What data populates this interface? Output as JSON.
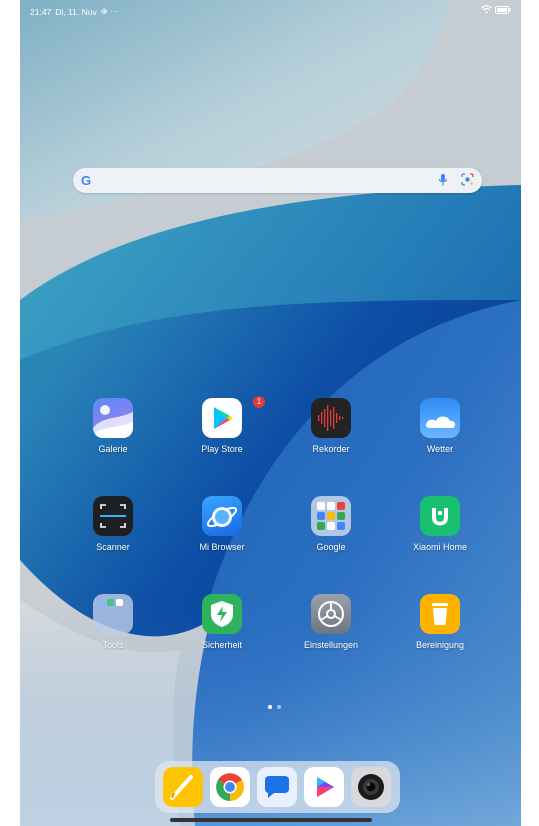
{
  "status_bar": {
    "time": "21:47",
    "date": "Di, 11. Nov",
    "extra": "⊕ ···",
    "right_icons": [
      "wifi-icon",
      "battery-icon"
    ]
  },
  "search_bar": {
    "logo": "G",
    "icons": [
      "mic-icon",
      "lens-icon"
    ]
  },
  "apps": [
    {
      "label": "Galerie",
      "icon": "gallery-icon"
    },
    {
      "label": "Play Store",
      "icon": "play-store-icon",
      "badge": "1"
    },
    {
      "label": "Rekorder",
      "icon": "recorder-icon"
    },
    {
      "label": "Wetter",
      "icon": "weather-icon"
    },
    {
      "label": "Scanner",
      "icon": "scanner-icon"
    },
    {
      "label": "Mi Browser",
      "icon": "browser-icon"
    },
    {
      "label": "Google",
      "icon": "google-folder-icon"
    },
    {
      "label": "Xiaomi Home",
      "icon": "xiaomi-home-icon"
    },
    {
      "label": "Tools",
      "icon": "tools-folder-icon"
    },
    {
      "label": "Sicherheit",
      "icon": "security-icon"
    },
    {
      "label": "Einstellungen",
      "icon": "settings-icon"
    },
    {
      "label": "Bereinigung",
      "icon": "cleaner-icon"
    }
  ],
  "page_indicator": {
    "pages": 2,
    "current": 1
  },
  "dock": [
    "notes-icon",
    "chrome-icon",
    "messages-icon",
    "game-launcher-icon",
    "camera-icon"
  ],
  "colors": {
    "wallpaper_blue": "#0a3a8c",
    "wallpaper_light": "#b9c4cc",
    "badge": "#e53935"
  }
}
